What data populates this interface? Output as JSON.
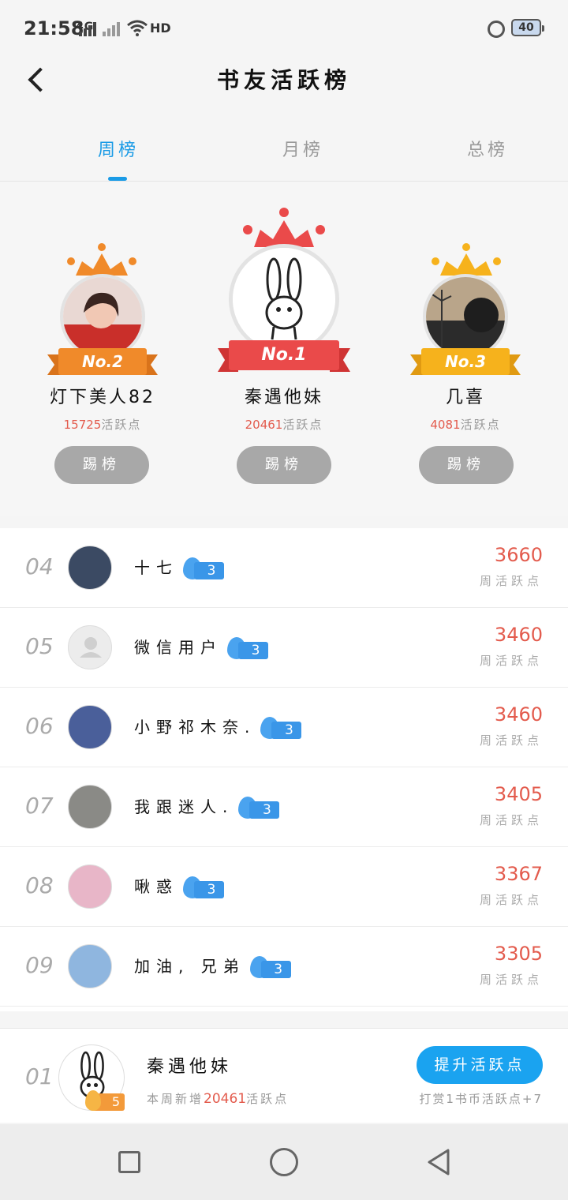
{
  "status_bar": {
    "time": "21:58",
    "network": "4G",
    "hd_label": "HD",
    "battery": "40"
  },
  "header": {
    "title": "书友活跃榜"
  },
  "tabs": [
    {
      "label": "周榜",
      "active": true
    },
    {
      "label": "月榜",
      "active": false
    },
    {
      "label": "总榜",
      "active": false
    }
  ],
  "podium": {
    "first": {
      "badge": "No.1",
      "name": "秦遇他妹",
      "points": "20461",
      "points_unit": "活跃点",
      "button": "踢榜",
      "ribbon_color": "#ea4a4a"
    },
    "second": {
      "badge": "No.2",
      "name": "灯下美人82",
      "points": "15725",
      "points_unit": "活跃点",
      "button": "踢榜",
      "ribbon_color": "#f08a2a"
    },
    "third": {
      "badge": "No.3",
      "name": "几喜",
      "points": "4081",
      "points_unit": "活跃点",
      "button": "踢榜",
      "ribbon_color": "#f6b21c"
    }
  },
  "ranking": [
    {
      "rank": "04",
      "name": "十七",
      "level": "3",
      "score": "3660",
      "score_label": "周活跃点"
    },
    {
      "rank": "05",
      "name": "微信用户",
      "level": "3",
      "score": "3460",
      "score_label": "周活跃点"
    },
    {
      "rank": "06",
      "name": "小野祁木奈.",
      "level": "3",
      "score": "3460",
      "score_label": "周活跃点"
    },
    {
      "rank": "07",
      "name": "我跟迷人.",
      "level": "3",
      "score": "3405",
      "score_label": "周活跃点"
    },
    {
      "rank": "08",
      "name": "啾惑",
      "level": "3",
      "score": "3367",
      "score_label": "周活跃点"
    },
    {
      "rank": "09",
      "name": "加油, 兄弟",
      "level": "3",
      "score": "3305",
      "score_label": "周活跃点"
    }
  ],
  "my_rank": {
    "rank": "01",
    "name": "秦遇他妹",
    "level": "5",
    "desc_prefix": "本周新增",
    "desc_value": "20461",
    "desc_suffix": "活跃点",
    "button": "提升活跃点",
    "hint": "打赏1书币活跃点+7"
  },
  "colors": {
    "accent": "#1a9be6",
    "score_red": "#e35b4d",
    "level_blue": "#3a96e8"
  }
}
